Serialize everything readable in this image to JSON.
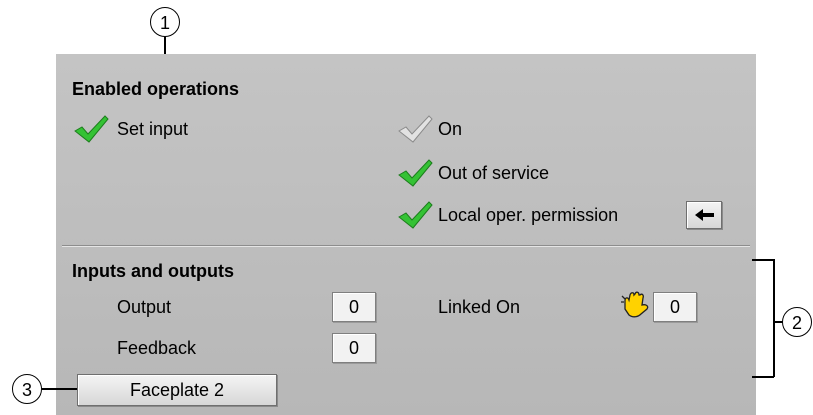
{
  "callouts": {
    "one": "1",
    "two": "2",
    "three": "3"
  },
  "enabled_operations": {
    "title": "Enabled operations",
    "set_input": "Set input",
    "on": "On",
    "out_of_service": "Out of service",
    "local_permission": "Local oper. permission"
  },
  "inputs_outputs": {
    "title": "Inputs and outputs",
    "output_label": "Output",
    "output_value": "0",
    "feedback_label": "Feedback",
    "feedback_value": "0",
    "linked_on_label": "Linked On",
    "linked_on_value": "0"
  },
  "faceplate_button": "Faceplate 2",
  "colors": {
    "panel": "#c0c0c0",
    "check_green": "#2fbf2f",
    "check_gray": "#d9d9d9"
  }
}
